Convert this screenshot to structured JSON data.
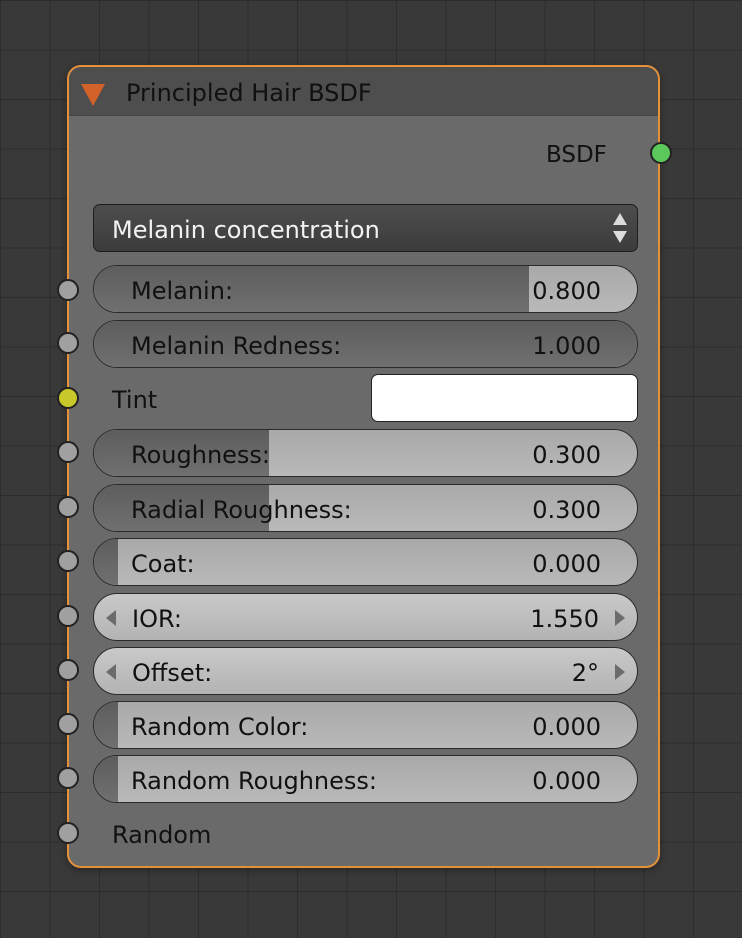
{
  "node": {
    "title": "Principled Hair BSDF",
    "accent_color": "#e4913a"
  },
  "output": {
    "label": "BSDF",
    "socket_color": "#5ac85a"
  },
  "parametrization": {
    "selected": "Melanin concentration"
  },
  "inputs": {
    "melanin": {
      "label": "Melanin:",
      "value": "0.800",
      "fill_fraction": 0.8
    },
    "melanin_redness": {
      "label": "Melanin Redness:",
      "value": "1.000",
      "fill_fraction": 1.0
    },
    "tint": {
      "label": "Tint",
      "color": "#ffffff",
      "socket_color": "#c8c82a"
    },
    "roughness": {
      "label": "Roughness:",
      "value": "0.300",
      "fill_fraction": 0.3
    },
    "radial_roughness": {
      "label": "Radial Roughness:",
      "value": "0.300",
      "fill_fraction": 0.3
    },
    "coat": {
      "label": "Coat:",
      "value": "0.000",
      "fill_fraction": 0.0
    },
    "ior": {
      "label": "IOR:",
      "value": "1.550"
    },
    "offset": {
      "label": "Offset:",
      "value": "2°"
    },
    "random_color": {
      "label": "Random Color:",
      "value": "0.000",
      "fill_fraction": 0.0
    },
    "random_roughness": {
      "label": "Random Roughness:",
      "value": "0.000",
      "fill_fraction": 0.0
    },
    "random": {
      "label": "Random"
    }
  }
}
